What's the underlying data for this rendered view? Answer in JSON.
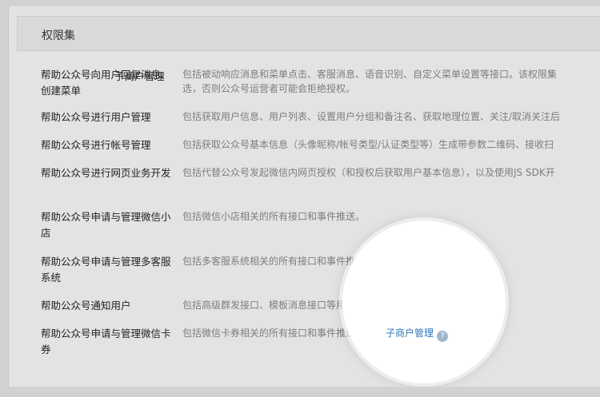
{
  "panel": {
    "title": "权限集"
  },
  "overlay": {
    "label": "子商户管理"
  },
  "rows": [
    {
      "name": "帮助公众号向用户回复消息、创建菜单",
      "desc_line1": "包括被动响应消息和菜单点击、客服消息、语音识别、自定义菜单设置等接口。该权限集",
      "desc_line2": "选，否则公众号运营者可能会拒绝授权。"
    },
    {
      "name": "帮助公众号进行用户管理",
      "desc_line1": "包括获取用户信息、用户列表、设置用户分组和备注名、获取地理位置、关注/取消关注后"
    },
    {
      "name": "帮助公众号进行帐号管理",
      "desc_line1": "包括获取公众号基本信息（头像昵称/帐号类型/认证类型等）生成带参数二维码、接收扫"
    },
    {
      "name": "帮助公众号进行网页业务开发",
      "desc_line1": "包括代替公众号发起微信内网页授权（和授权后获取用户基本信息），以及使用JS SDK开"
    },
    {
      "name": "帮助公众号申请与管理微信小店",
      "desc_line1": "包括微信小店相关的所有接口和事件推送。"
    },
    {
      "name": "帮助公众号申请与管理多客服系统",
      "desc_line1": "包括多客服系统相关的所有接口和事件推送。"
    },
    {
      "name": "帮助公众号通知用户",
      "desc_line1": "包括高级群发接口、模板消息接口等用于通知用户的接口。"
    },
    {
      "name": "帮助公众号申请与管理微信卡券",
      "desc_line1": "包括微信卡券相关的所有接口和事件推送。",
      "link": "子商户管理",
      "help_icon": "?"
    }
  ]
}
